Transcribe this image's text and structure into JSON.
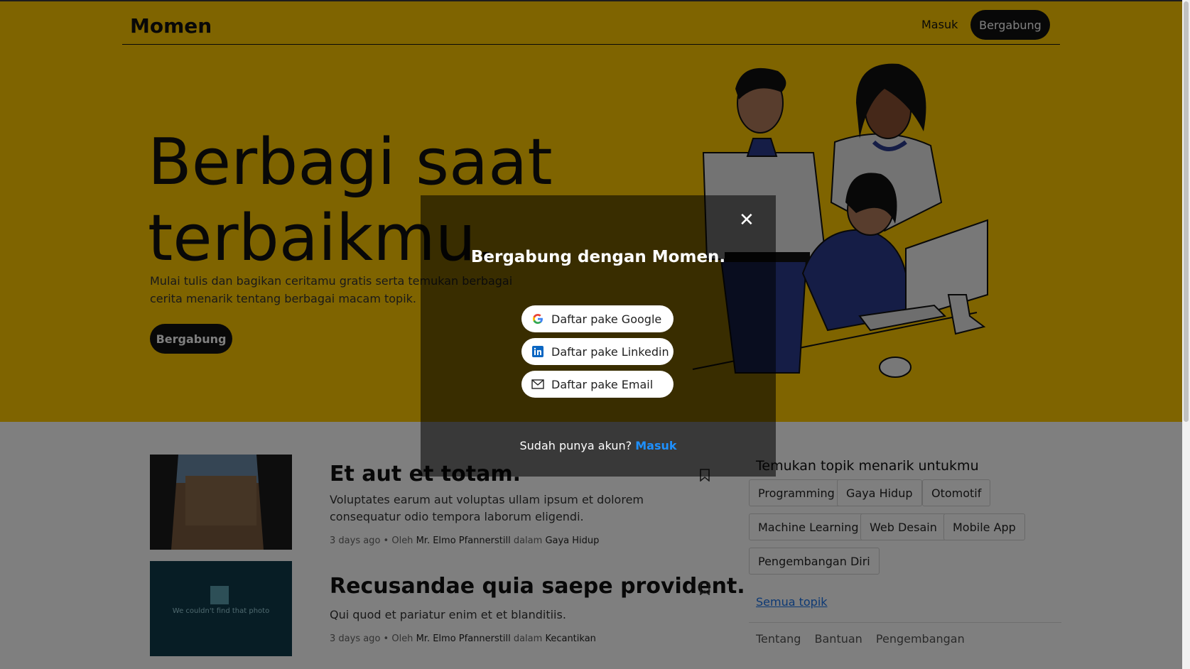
{
  "header": {
    "brand": "Momen",
    "login": "Masuk",
    "join": "Bergabung"
  },
  "hero": {
    "title": "Berbagi saat terbaikmu.",
    "subtitle": "Mulai tulis dan bagikan ceritamu gratis serta temukan berbagai cerita menarik tentang berbagai macam topik.",
    "cta": "Bergabung",
    "bg_color": "#ffc800"
  },
  "articles": [
    {
      "title": "Et aut et totam.",
      "description": "Voluptates earum aut voluptas ullam ipsum et dolorem consequatur odio tempora laborum eligendi.",
      "time": "3 days ago",
      "by": "Oleh",
      "author": "Mr. Elmo Pfannerstill",
      "in": "dalam",
      "topic": "Gaya Hidup"
    },
    {
      "title": "Recusandae quia saepe provident.",
      "description": "Qui quod et pariatur enim et et blanditiis.",
      "time": "3 days ago",
      "by": "Oleh",
      "author": "Mr. Elmo Pfannerstill",
      "in": "dalam",
      "topic": "Kecantikan",
      "image_text": "We couldn't find that photo"
    }
  ],
  "topics": {
    "heading": "Temukan topik menarik untukmu",
    "items": [
      "Programming",
      "Gaya Hidup",
      "Otomotif",
      "Machine Learning",
      "Web Desain",
      "Mobile App",
      "Pengembangan Diri"
    ],
    "all_link": "Semua topik"
  },
  "footer": {
    "links": [
      "Tentang",
      "Bantuan",
      "Pengembangan"
    ]
  },
  "modal": {
    "title": "Bergabung dengan Momen.",
    "buttons": {
      "google": "Daftar pake Google",
      "linkedin": "Daftar pake Linkedin",
      "email": "Daftar pake Email"
    },
    "footer_text": "Sudah punya akun?",
    "footer_link": "Masuk",
    "icons": [
      "close-icon",
      "google-icon",
      "linkedin-icon",
      "email-icon"
    ]
  }
}
